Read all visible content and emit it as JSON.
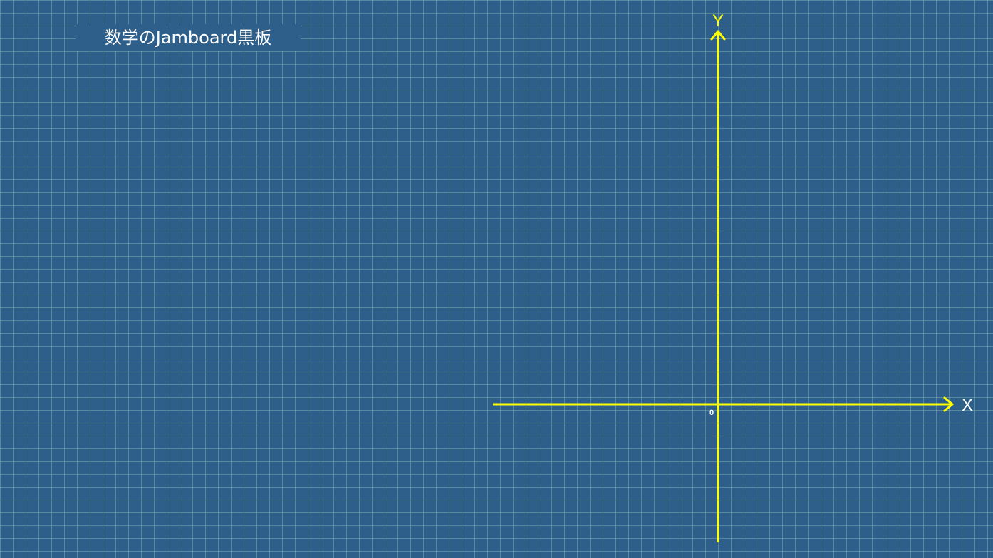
{
  "board": {
    "title": "数学のJamboard黒板",
    "grid": true,
    "background_color": "#2e5f8a",
    "grid_color": "#78aaaa"
  },
  "axes": {
    "x_label": "X",
    "y_label": "Y",
    "origin_label": "0",
    "axis_color": "#ffff00",
    "x_label_color": "#ffffff",
    "y_label_color": "#ffff00"
  }
}
